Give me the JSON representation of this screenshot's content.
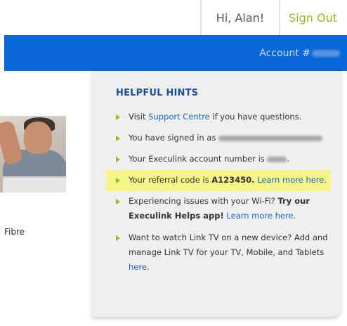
{
  "header": {
    "greeting": "Hi, Alan!",
    "sign_out_label": "Sign Out"
  },
  "account_bar": {
    "account_label": "Account #"
  },
  "left": {
    "fibre_label": "Fibre"
  },
  "hints": {
    "title": "HELPFUL HINTS",
    "items": [
      {
        "pre": "Visit ",
        "link": "Support Centre",
        "post": " if you have questions."
      },
      {
        "pre": "You have signed in as "
      },
      {
        "pre": "Your Execulink account number is "
      },
      {
        "pre": "Your referral code is ",
        "code": "A123450.",
        "link": "Learn more here."
      },
      {
        "pre": "Experiencing issues with your Wi-Fi? ",
        "bold": "Try our Execulink Helps app!",
        "link": "Learn more here",
        "post": "."
      },
      {
        "pre": "Want to watch Link TV on a new device? Add and manage Link TV for your TV, Mobile, and Tablets ",
        "link": "here",
        "post": "."
      }
    ]
  },
  "colors": {
    "brand_blue": "#0a67d8",
    "accent_green": "#8cbd2b",
    "highlight_yellow": "#f5f58a",
    "title_blue": "#1b4f9c"
  }
}
